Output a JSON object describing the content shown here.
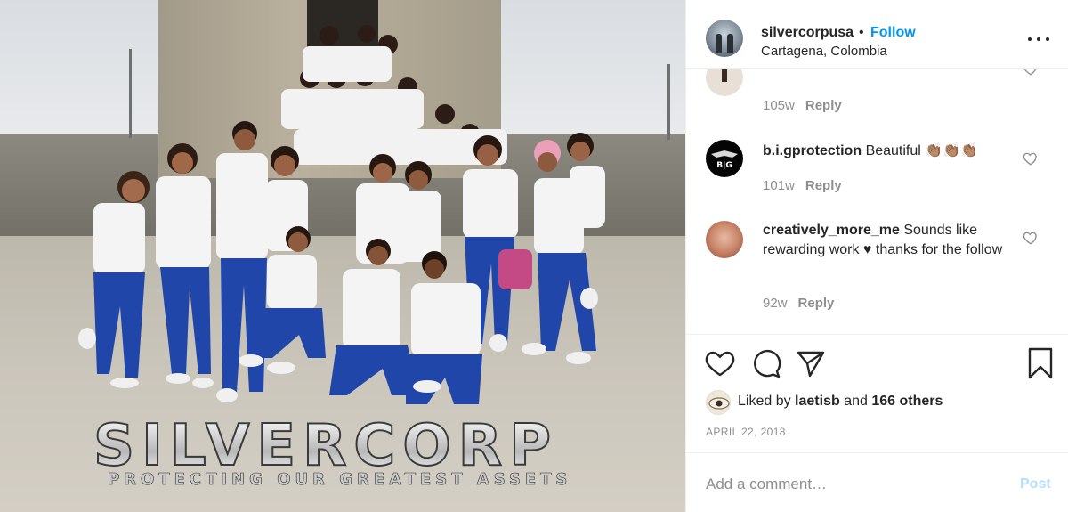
{
  "post": {
    "header": {
      "username": "silvercorpusa",
      "separator": "•",
      "follow_label": "Follow",
      "location": "Cartagena, Colombia",
      "more_icon": "more-horizontal-icon"
    },
    "photo": {
      "watermark_title": "SILVERCORP",
      "watermark_subtitle": "PROTECTING OUR GREATEST ASSETS"
    },
    "comments": [
      {
        "username": "",
        "text": "",
        "age": "105w",
        "reply_label": "Reply"
      },
      {
        "username": "b.i.gprotection",
        "text": "Beautiful 👏🏽👏🏽👏🏽",
        "age": "101w",
        "reply_label": "Reply",
        "avatar_text": "BG"
      },
      {
        "username": "creatively_more_me",
        "text": "Sounds like rewarding work ♥ thanks for the follow",
        "age": "92w",
        "reply_label": "Reply"
      }
    ],
    "actions": {
      "like_icon": "heart-icon",
      "comment_icon": "comment-icon",
      "share_icon": "send-icon",
      "save_icon": "bookmark-icon"
    },
    "likes": {
      "prefix": "Liked by",
      "user": "laetisb",
      "joiner": "and",
      "others": "166 others"
    },
    "date": "APRIL 22, 2018",
    "add_comment": {
      "placeholder": "Add a comment…",
      "post_label": "Post"
    },
    "colors": {
      "link_blue": "#0095f6",
      "post_disabled": "#b2dffc",
      "muted": "#8e8e8e"
    }
  }
}
